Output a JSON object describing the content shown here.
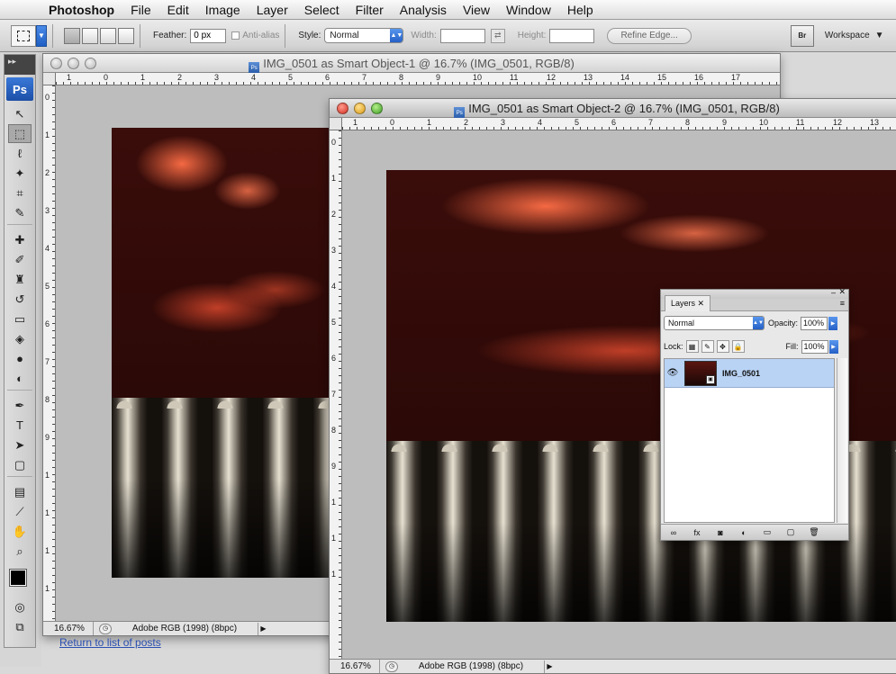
{
  "menubar": {
    "app": "Photoshop",
    "items": [
      "File",
      "Edit",
      "Image",
      "Layer",
      "Select",
      "Filter",
      "Analysis",
      "View",
      "Window",
      "Help"
    ]
  },
  "options": {
    "feather_label": "Feather:",
    "feather_value": "0 px",
    "antialias_label": "Anti-alias",
    "style_label": "Style:",
    "style_value": "Normal",
    "width_label": "Width:",
    "height_label": "Height:",
    "refine_label": "Refine Edge...",
    "bridge_label": "Br",
    "workspace_label": "Workspace"
  },
  "toolbox": {
    "logo": "Ps",
    "tools": [
      {
        "name": "move-tool",
        "glyph": "↖"
      },
      {
        "name": "marquee-tool",
        "glyph": "⬚"
      },
      {
        "name": "lasso-tool",
        "glyph": "ℓ"
      },
      {
        "name": "magic-wand-tool",
        "glyph": "✦"
      },
      {
        "name": "crop-tool",
        "glyph": "⌗"
      },
      {
        "name": "eyedropper-tool",
        "glyph": "✎"
      },
      {
        "name": "healing-tool",
        "glyph": "✚"
      },
      {
        "name": "brush-tool",
        "glyph": "✐"
      },
      {
        "name": "stamp-tool",
        "glyph": "♜"
      },
      {
        "name": "history-brush-tool",
        "glyph": "↺"
      },
      {
        "name": "eraser-tool",
        "glyph": "▭"
      },
      {
        "name": "bucket-tool",
        "glyph": "◈"
      },
      {
        "name": "blur-tool",
        "glyph": "●"
      },
      {
        "name": "dodge-tool",
        "glyph": "◐"
      },
      {
        "name": "pen-tool",
        "glyph": "✒"
      },
      {
        "name": "type-tool",
        "glyph": "T"
      },
      {
        "name": "path-select-tool",
        "glyph": "➤"
      },
      {
        "name": "shape-tool",
        "glyph": "▢"
      },
      {
        "name": "notes-tool",
        "glyph": "▤"
      },
      {
        "name": "eyedropper2-tool",
        "glyph": "⟋"
      },
      {
        "name": "hand-tool",
        "glyph": "✋"
      },
      {
        "name": "zoom-tool",
        "glyph": "⌕"
      }
    ]
  },
  "doc1": {
    "title": "IMG_0501 as Smart Object-1 @ 16.7% (IMG_0501, RGB/8)",
    "zoom": "16.67%",
    "profile": "Adobe RGB (1998) (8bpc)",
    "ruler_ticks": [
      "1",
      "0",
      "1",
      "2",
      "3",
      "4",
      "5",
      "6",
      "7",
      "8",
      "9",
      "10",
      "11",
      "12",
      "13",
      "14",
      "15",
      "16",
      "17"
    ],
    "vruler_ticks": [
      "0",
      "1",
      "2",
      "3",
      "4",
      "5",
      "6",
      "7",
      "8",
      "9",
      "1",
      "1",
      "1",
      "1"
    ]
  },
  "doc2": {
    "title": "IMG_0501 as Smart Object-2 @ 16.7% (IMG_0501, RGB/8)",
    "zoom": "16.67%",
    "profile": "Adobe RGB (1998) (8bpc)",
    "ruler_ticks": [
      "1",
      "0",
      "1",
      "2",
      "3",
      "4",
      "5",
      "6",
      "7",
      "8",
      "9",
      "10",
      "11",
      "12",
      "13"
    ],
    "vruler_ticks": [
      "0",
      "1",
      "2",
      "3",
      "4",
      "5",
      "6",
      "7",
      "8",
      "9",
      "1",
      "1",
      "1"
    ]
  },
  "layers": {
    "tab": "Layers",
    "blend": "Normal",
    "opacity_label": "Opacity:",
    "opacity": "100%",
    "lock_label": "Lock:",
    "fill_label": "Fill:",
    "fill": "100%",
    "layer_name": "IMG_0501"
  },
  "page": {
    "return_link": "Return to list of posts"
  }
}
